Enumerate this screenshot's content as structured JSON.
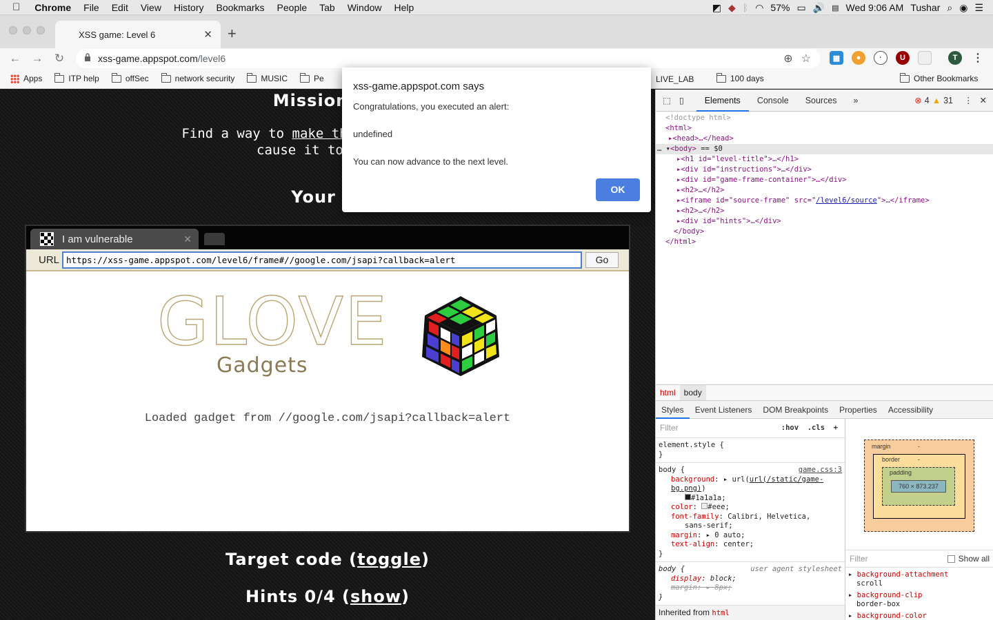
{
  "menubar": {
    "app": "Chrome",
    "items": [
      "File",
      "Edit",
      "View",
      "History",
      "Bookmarks",
      "People",
      "Tab",
      "Window",
      "Help"
    ],
    "battery": "57%",
    "clock": "Wed 9:06 AM",
    "user": "Tushar"
  },
  "browser": {
    "tab_title": "XSS game: Level 6",
    "url_host": "xss-game.appspot.com",
    "url_path": "/level6",
    "profile_initial": "T",
    "bookmarks": [
      "Apps",
      "ITP help",
      "offSec",
      "network security",
      "MUSIC",
      "Pe",
      "LIVE_LAB",
      "100 days"
    ],
    "other_bookmarks": "Other Bookmarks"
  },
  "page": {
    "mission_title": "Mission Ob",
    "instructions_pre": "Find a way to ",
    "instructions_link": "make the application re",
    "instructions_line2": "cause it to execut",
    "target_title": "Your Ta",
    "frame_tab_title": "I am vulnerable",
    "frame_url_label": "URL",
    "frame_url": "https://xss-game.appspot.com/level6/frame#//google.com/jsapi?callback=alert",
    "go_label": "Go",
    "logo_word": "GLOVE",
    "logo_sub": "Gadgets",
    "loaded_text": "Loaded gadget from //google.com/jsapi?callback=alert",
    "target_code_label": "Target code (",
    "target_code_link": "toggle",
    "target_code_close": ")",
    "hints_label": "Hints 0/4 (",
    "hints_link": "show",
    "hints_close": ")"
  },
  "alert": {
    "title": "xss-game.appspot.com says",
    "line1": "Congratulations, you executed an alert:",
    "line2": "undefined",
    "line3": "You can now advance to the next level.",
    "ok": "OK"
  },
  "devtools": {
    "tabs": [
      "Elements",
      "Console",
      "Sources",
      "»"
    ],
    "errors": "4",
    "warnings": "31",
    "dom": {
      "doctype": "<!doctype html>",
      "html_open": "<html>",
      "head": "<head>…</head>",
      "body_open": "<body>",
      "body_eq": " == $0",
      "h1": "<h1 id=\"level-title\">…</h1>",
      "div_instr": "<div id=\"instructions\">…</div>",
      "div_frame": "<div id=\"game-frame-container\">…</div>",
      "h2a": "<h2>…</h2>",
      "iframe_pre": "<iframe id=\"source-frame\" src=\"",
      "iframe_src": "/level6/source",
      "iframe_post": "\">…</iframe>",
      "h2b": "<h2>…</h2>",
      "div_hints": "<div id=\"hints\">…</div>",
      "body_close": "</body>",
      "html_close": "</html>"
    },
    "crumbs": [
      "html",
      "body"
    ],
    "subtabs": [
      "Styles",
      "Event Listeners",
      "DOM Breakpoints",
      "Properties",
      "Accessibility"
    ],
    "filter_placeholder": "Filter",
    "hov": ":hov",
    "cls": ".cls",
    "element_style": "element.style {",
    "body_rule": {
      "selector": "body {",
      "source": "game.css:3",
      "background": "url(/static/game-bg.png)",
      "bg_color": "#1a1a1a;",
      "color": "#eee;",
      "font_family": "Calibri, Helvetica,",
      "font_family2": "sans-serif;",
      "margin": "0 auto;",
      "text_align": "center;"
    },
    "ua_rule": {
      "selector": "body {",
      "source": "user agent stylesheet",
      "display": "block;",
      "margin": "8px;"
    },
    "inherited_from": "Inherited from",
    "inherited_el": "html",
    "boxmodel": {
      "margin": "margin",
      "border": "border",
      "padding": "padding",
      "content": "760 × 873.237",
      "dash": "-"
    },
    "computed": {
      "filter": "Filter",
      "show_all": "Show all",
      "items": [
        {
          "name": "background-attachment",
          "value": "scroll"
        },
        {
          "name": "background-clip",
          "value": "border-box"
        },
        {
          "name": "background-color",
          "value": ""
        }
      ]
    }
  }
}
